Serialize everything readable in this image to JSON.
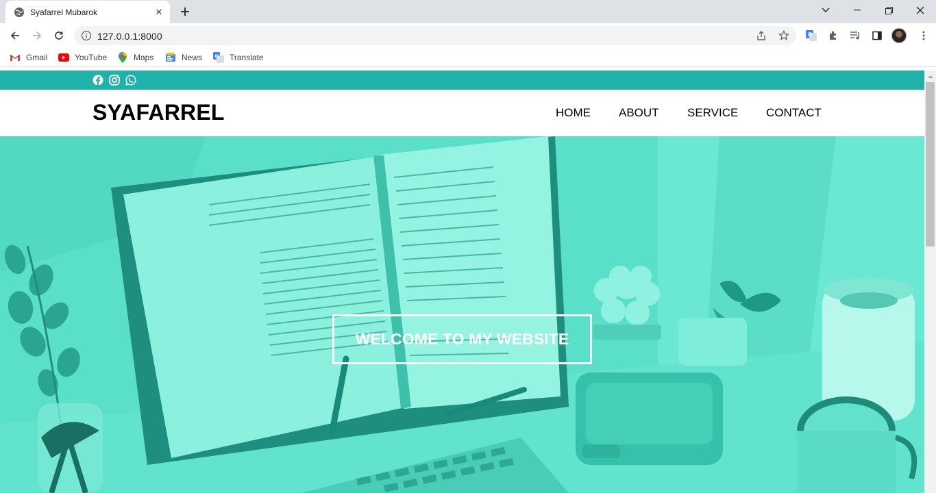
{
  "browser": {
    "tab_title": "Syafarrel Mubarok",
    "url": "127.0.0.1:8000",
    "bookmarks": [
      {
        "label": "Gmail",
        "icon": "gmail-icon"
      },
      {
        "label": "YouTube",
        "icon": "youtube-icon"
      },
      {
        "label": "Maps",
        "icon": "maps-icon"
      },
      {
        "label": "News",
        "icon": "news-icon"
      },
      {
        "label": "Translate",
        "icon": "translate-icon"
      }
    ]
  },
  "site": {
    "topbar_color": "#20b2aa",
    "social_icons": [
      "facebook-icon",
      "instagram-icon",
      "whatsapp-icon"
    ],
    "brand": "SYAFARREL",
    "nav": [
      {
        "label": "HOME"
      },
      {
        "label": "ABOUT"
      },
      {
        "label": "SERVICE"
      },
      {
        "label": "CONTACT"
      }
    ],
    "hero": {
      "heading": "WELCOME TO MY WEBSITE",
      "overlay_color": "#5ae0c9"
    }
  }
}
